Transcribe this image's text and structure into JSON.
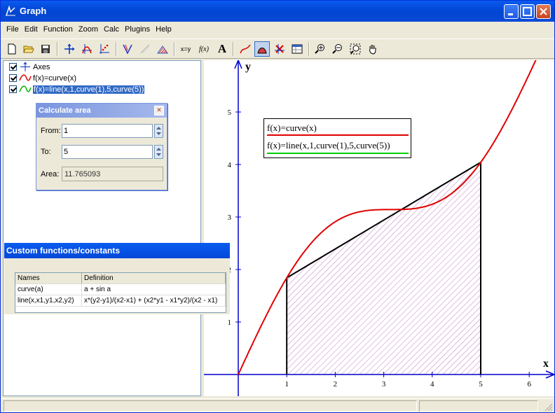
{
  "window": {
    "title": "Graph"
  },
  "menu": [
    "File",
    "Edit",
    "Function",
    "Zoom",
    "Calc",
    "Plugins",
    "Help"
  ],
  "toolbar": {
    "text_eval": "x=y",
    "text_func": "f(x)",
    "text_font": "A"
  },
  "tree": [
    {
      "label": "Axes",
      "icon": "axes-icon"
    },
    {
      "label": "f(x)=curve(x)",
      "icon": "red-curve-icon"
    },
    {
      "label": "f(x)=line(x,1,curve(1),5,curve(5))",
      "icon": "green-curve-icon"
    }
  ],
  "calc_area": {
    "title": "Calculate area",
    "from_label": "From:",
    "from_value": "1",
    "to_label": "To:",
    "to_value": "5",
    "area_label": "Area:",
    "area_value": "11.765093"
  },
  "custom_functions": {
    "title": "Custom functions/constants",
    "headers": [
      "Names",
      "Definition"
    ],
    "rows": [
      {
        "name": "curve(a)",
        "definition": "a + sin a"
      },
      {
        "name": "line(x,x1,y1,x2,y2)",
        "definition": "x*(y2-y1)/(x2-x1) + (x2*y1 - x1*y2)/(x2 - x1)"
      }
    ]
  },
  "plot": {
    "axis_x_label": "x",
    "axis_y_label": "y",
    "x_ticks": [
      "1",
      "2",
      "3",
      "4",
      "5",
      "6"
    ],
    "y_ticks": [
      "1",
      "2",
      "3",
      "4",
      "5"
    ],
    "legend": [
      "f(x)=curve(x)",
      "f(x)=line(x,1,curve(1),5,curve(5))"
    ],
    "colors": {
      "curve": "#e00000",
      "line": "#000000",
      "legend_line": "#00cc00",
      "axes": "#0000cc",
      "hatch": "#c080c0"
    }
  },
  "chart_data": {
    "type": "line",
    "xlabel": "x",
    "ylabel": "y",
    "xlim": [
      -0.7,
      6.5
    ],
    "ylim": [
      -0.3,
      6.2
    ],
    "series": [
      {
        "name": "f(x)=curve(x)",
        "function": "x + sin x"
      },
      {
        "name": "f(x)=line(x,1,curve(1),5,curve(5))",
        "points": [
          [
            1,
            1.841
          ],
          [
            5,
            4.041
          ]
        ]
      }
    ],
    "area": {
      "from": 1,
      "to": 5,
      "value": 11.765093
    }
  }
}
